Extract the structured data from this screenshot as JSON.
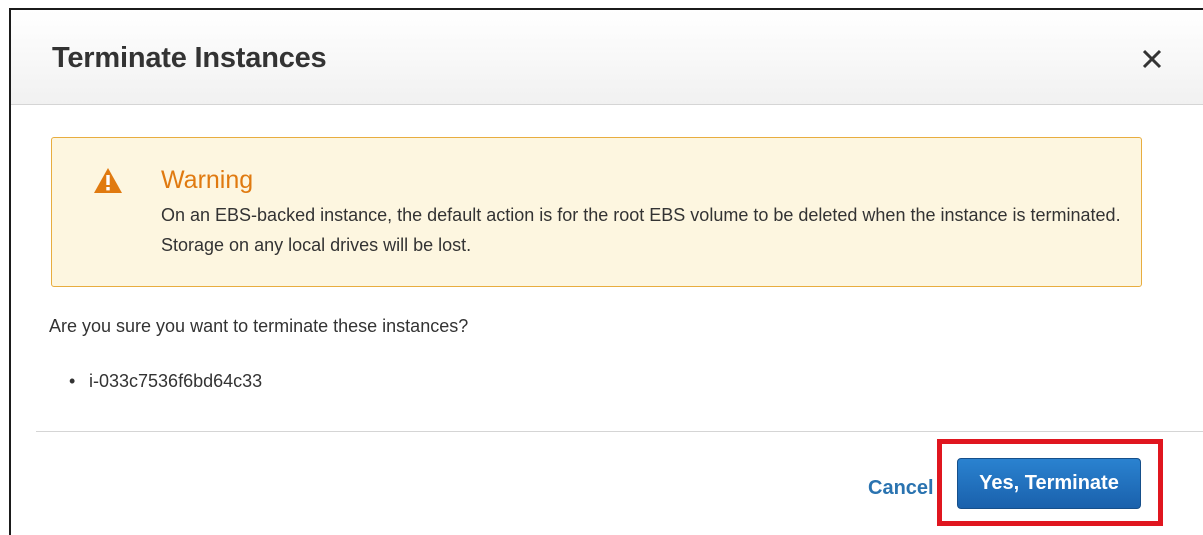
{
  "dialog": {
    "title": "Terminate Instances",
    "close_icon": "close-icon"
  },
  "warning": {
    "icon": "warning-triangle-icon",
    "title": "Warning",
    "message": "On an EBS-backed instance, the default action is for the root EBS volume to be deleted when the instance is terminated. Storage on any local drives will be lost."
  },
  "confirmation": {
    "question": "Are you sure you want to terminate these instances?",
    "instances": [
      "i-033c7536f6bd64c33"
    ]
  },
  "footer": {
    "cancel_label": "Cancel",
    "confirm_label": "Yes, Terminate"
  },
  "colors": {
    "warning_border": "#e8ad3f",
    "warning_background": "#fdf6e0",
    "warning_title": "#e07a10",
    "primary_button": "#1f6fc0",
    "cancel_link": "#2a73b0",
    "highlight_box": "#e0161f"
  }
}
